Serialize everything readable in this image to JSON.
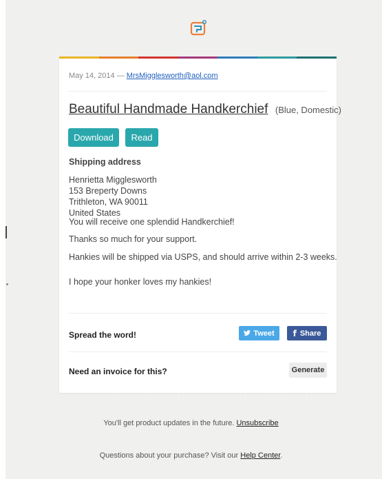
{
  "header": {
    "logo_icon": "receipt-logo-icon"
  },
  "rainbow_colors": [
    "#e9b524",
    "#e7802b",
    "#d2342f",
    "#a63a7d",
    "#2d7bb8",
    "#2c9aa0",
    "#1c6f73"
  ],
  "meta": {
    "date": "May 14, 2014 —",
    "email": "MrsMigglesworth@aol.com"
  },
  "product": {
    "title": "Beautiful Handmade Handkerchief",
    "variant": "(Blue, Domestic)"
  },
  "actions": {
    "download_label": "Download",
    "read_label": "Read"
  },
  "shipping": {
    "heading": "Shipping address",
    "name": "Henrietta Migglesworth",
    "street": "153 Breperty Downs",
    "city": "Trithleton, WA 90011",
    "country": "United States"
  },
  "messages": [
    "You will receive one splendid Handkerchief!",
    "Thanks so much for your support.",
    "Hankies will be shipped via USPS, and should arrive within 2-3 weeks.",
    "I hope your honker loves my hankies!"
  ],
  "spread": {
    "label": "Spread the word!",
    "tweet_label": "Tweet",
    "tweet_icon": "twitter-bird-icon",
    "share_label": "Share",
    "share_icon": "facebook-f-icon"
  },
  "invoice": {
    "label": "Need an invoice for this?",
    "button_label": "Generate"
  },
  "footer": {
    "updates_text": "You'll get product updates in the future.",
    "unsubscribe": "Unsubscribe",
    "questions_text": "Questions about your purchase? Visit our",
    "help_center": "Help Center",
    "period": "."
  },
  "colors": {
    "accent": "#2aa7ac",
    "twitter": "#4aa8e8",
    "facebook": "#3b5998"
  }
}
